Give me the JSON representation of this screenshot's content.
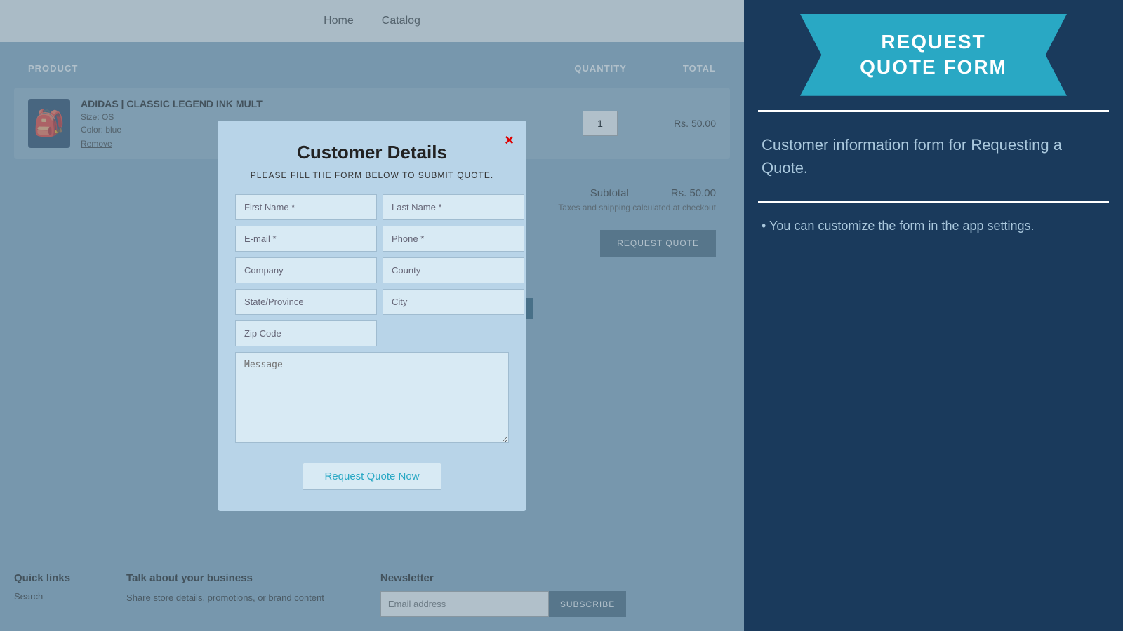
{
  "nav": {
    "links": [
      "Home",
      "Catalog"
    ]
  },
  "table": {
    "columns": {
      "product": "PRODUCT",
      "quantity": "QUANTITY",
      "total": "TOTAL"
    }
  },
  "product": {
    "name": "ADIDAS | CLASSIC LEGEND INK MULT",
    "size_label": "Size: OS",
    "color_label": "Color: blue",
    "remove_label": "Remove",
    "quantity": "1",
    "price": "Rs. 50.00"
  },
  "subtotal": {
    "label": "Subtotal",
    "amount": "Rs. 50.00",
    "tax_note": "Taxes and shipping calculated at checkout",
    "request_quote_btn": "REQUEST QUOTE"
  },
  "modal": {
    "title": "Customer Details",
    "subtitle": "PLEASE FILL THE FORM BELOW TO SUBMIT QUOTE.",
    "close_label": "×",
    "fields": {
      "first_name_placeholder": "First Name *",
      "last_name_placeholder": "Last Name *",
      "email_placeholder": "E-mail *",
      "phone_placeholder": "Phone *",
      "company_placeholder": "Company",
      "county_placeholder": "County",
      "state_placeholder": "State/Province",
      "city_placeholder": "City",
      "zip_placeholder": "Zip Code",
      "message_placeholder": "Message"
    },
    "submit_label": "Request Quote Now"
  },
  "right_panel": {
    "banner_line1": "REQUEST",
    "banner_line2": "QUOTE FORM",
    "description": "Customer information form for Requesting a Quote.",
    "tip": "• You can customize the form in the app settings."
  },
  "footer": {
    "quick_links": {
      "title": "Quick links",
      "search": "Search"
    },
    "business": {
      "title": "Talk about your business",
      "text": "Share store details, promotions, or brand content"
    },
    "newsletter": {
      "title": "Newsletter",
      "email_placeholder": "Email address",
      "subscribe_btn": "SUBSCRIBE"
    }
  }
}
